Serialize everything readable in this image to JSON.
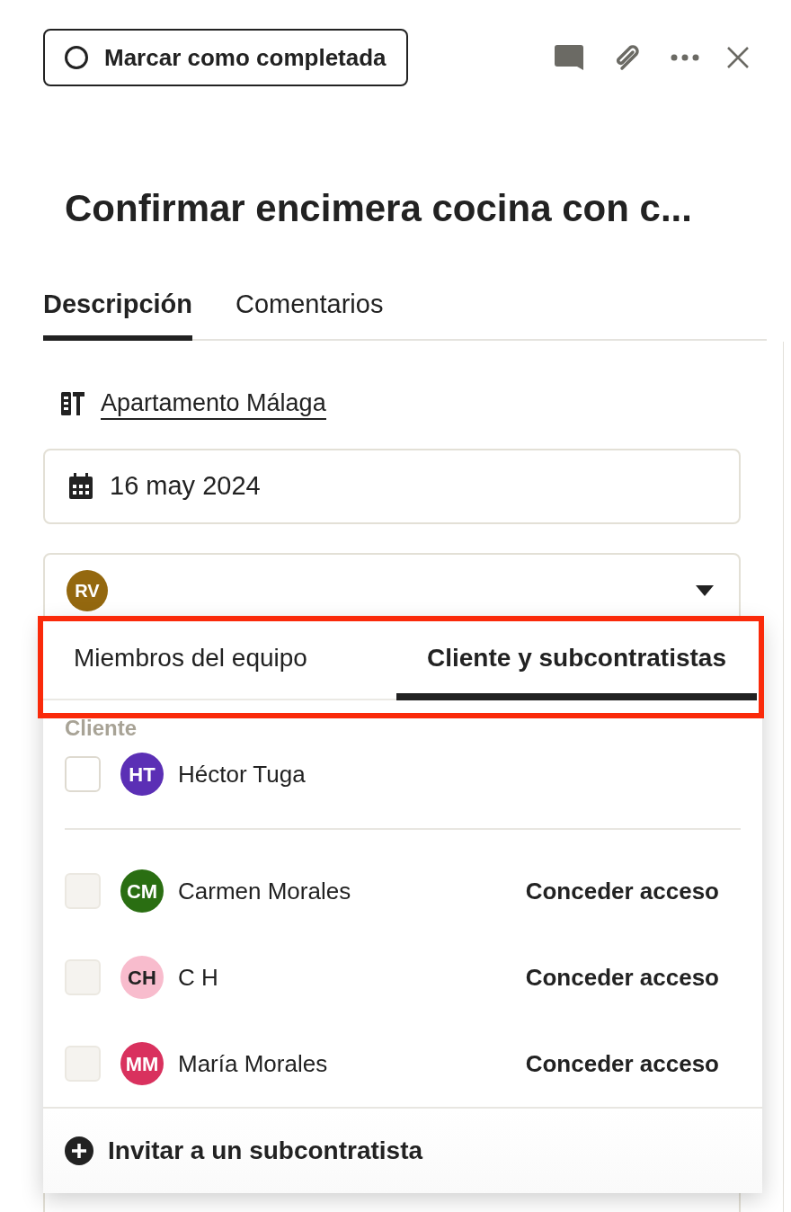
{
  "toolbar": {
    "complete_button": {
      "label": "Marcar como completada",
      "checked": false
    }
  },
  "title": "Confirmar encimera cocina con c...",
  "tabs": [
    {
      "label": "Descripción",
      "selected": true
    },
    {
      "label": "Comentarios",
      "selected": false
    }
  ],
  "project": {
    "label": "Apartamento Málaga"
  },
  "date_field": {
    "value": "16 may 2024"
  },
  "assignee_field": {
    "expanded": true,
    "avatars": [
      {
        "initials": "RV",
        "color": "#94680f"
      }
    ]
  },
  "dropdown": {
    "highlighted": true,
    "tabs": [
      {
        "label": "Miembros del equipo",
        "selected": false
      },
      {
        "label": "Cliente y subcontratistas",
        "selected": true
      }
    ],
    "sections": [
      {
        "heading": "Cliente",
        "people": [
          {
            "initials": "HT",
            "name": "Héctor Tuga",
            "color": "#5b2fb5",
            "checked": false,
            "disabled": false
          }
        ]
      },
      {
        "people": [
          {
            "initials": "CM",
            "name": "Carmen Morales",
            "color": "#2a6e12",
            "checked": false,
            "disabled": true,
            "action": "Conceder acceso"
          },
          {
            "initials": "CH",
            "name": "C H",
            "color": "#f8bccd",
            "checked": false,
            "disabled": true,
            "action": "Conceder acceso"
          },
          {
            "initials": "MM",
            "name": "María Morales",
            "color": "#d9315e",
            "checked": false,
            "disabled": true,
            "action": "Conceder acceso"
          }
        ]
      }
    ],
    "footer": {
      "label": "Invitar a un subcontratista"
    }
  }
}
